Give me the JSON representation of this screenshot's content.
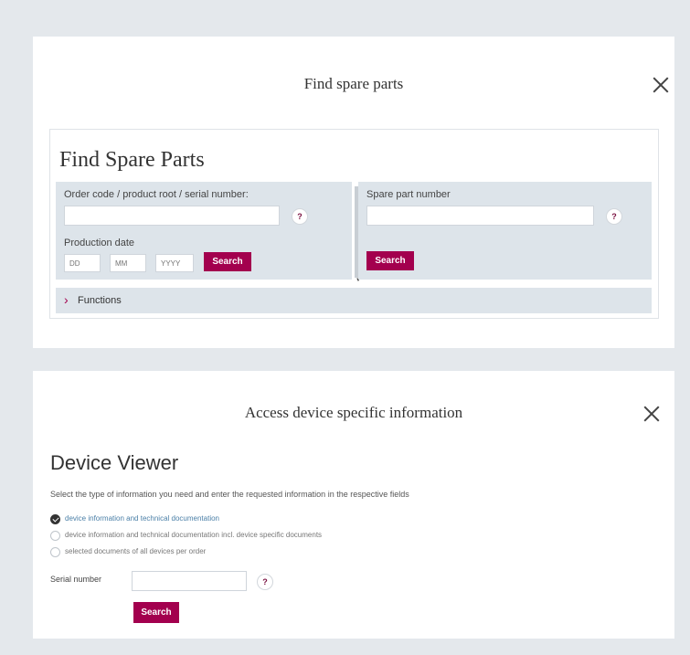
{
  "spare_parts_modal": {
    "title": "Find spare parts",
    "heading": "Find Spare Parts",
    "order_code_label": "Order code / product root / serial number:",
    "order_code_value": "",
    "help_label": "?",
    "production_date_label": "Production date",
    "date_fields": {
      "day_placeholder": "DD",
      "month_placeholder": "MM",
      "year_placeholder": "YYYY"
    },
    "search_label": "Search",
    "spare_part_label": "Spare part number",
    "spare_part_value": "",
    "functions_label": "Functions"
  },
  "device_modal": {
    "title": "Access device specific information",
    "heading": "Device Viewer",
    "instructions": "Select the type of information you need and enter the requested information in the respective fields",
    "options": [
      {
        "label": "device information and technical documentation",
        "selected": true
      },
      {
        "label": "device information and technical documentation incl. device specific documents",
        "selected": false
      },
      {
        "label": "selected documents of all devices per order",
        "selected": false
      }
    ],
    "serial_label": "Serial number",
    "serial_value": "",
    "help_label": "?",
    "search_label": "Search"
  },
  "colors": {
    "accent": "#a3004e",
    "background": "#e4e8ec",
    "form_box": "#dde4ea",
    "link": "#4a7fa7"
  },
  "icons": {
    "close": "close-icon",
    "chevron": "chevron-right-icon",
    "radio_checked": "check-circle-icon"
  }
}
